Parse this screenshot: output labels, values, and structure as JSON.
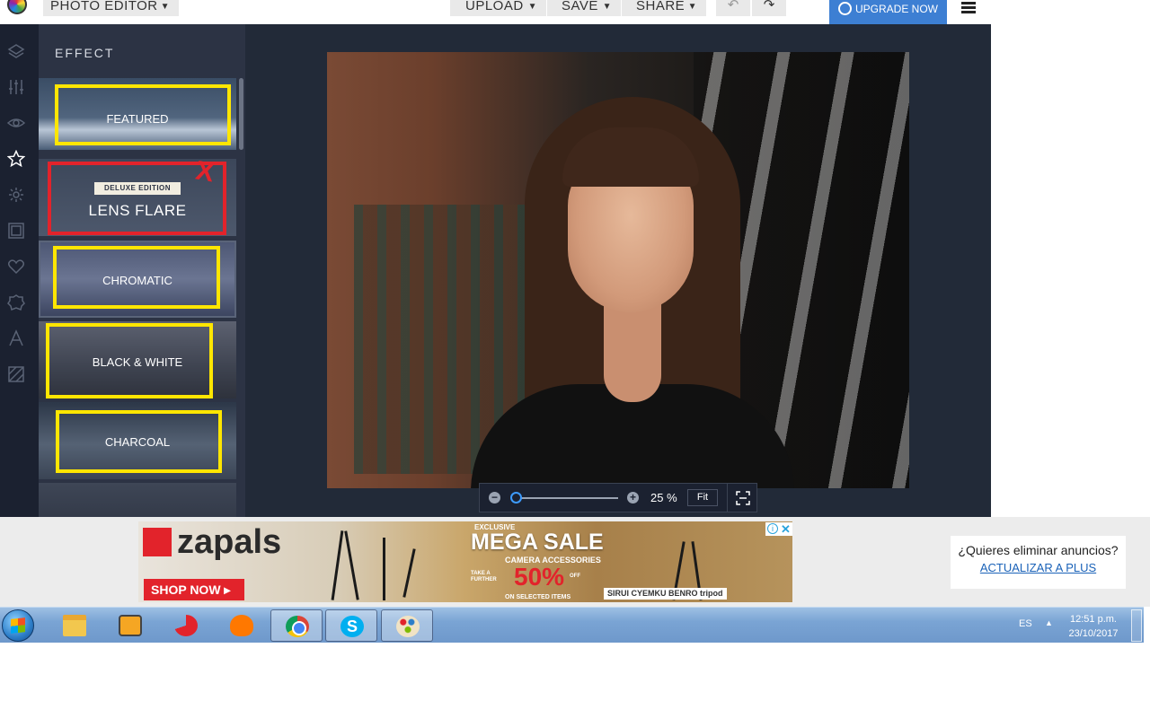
{
  "topbar": {
    "app_menu": "PHOTO EDITOR",
    "upload": "UPLOAD",
    "save": "SAVE",
    "share": "SHARE",
    "upgrade": "UPGRADE NOW",
    "caret": "▼",
    "undo_glyph": "↶",
    "redo_glyph": "↷"
  },
  "rail": {
    "icons": [
      "layers-icon",
      "sliders-icon",
      "eye-icon",
      "star-icon",
      "sparkle-icon",
      "frame-icon",
      "heart-icon",
      "badge-icon",
      "text-icon",
      "texture-icon"
    ],
    "active": "star-icon"
  },
  "effects": {
    "title": "EFFECT",
    "items": [
      {
        "label": "FEATURED"
      },
      {
        "label": "LENS FLARE",
        "ribbon": "DELUXE EDITION",
        "mark": "X"
      },
      {
        "label": "CHROMATIC"
      },
      {
        "label": "BLACK & WHITE"
      },
      {
        "label": "CHARCOAL"
      }
    ],
    "highlight_color": "#ffe600",
    "reject_color": "#e2232b"
  },
  "zoom": {
    "minus": "−",
    "plus": "+",
    "value": "25 %",
    "fit": "Fit",
    "level": 0.0
  },
  "ad": {
    "brand": "zapals",
    "cta": "SHOP NOW ▸",
    "exclusive": "EXCLUSIVE",
    "headline": "MEGA SALE",
    "sub": "CAMERA ACCESSORIES",
    "take": "TAKE A FURTHER",
    "discount": "50%",
    "off": "OFF",
    "on_selected": "ON SELECTED ITEMS",
    "brands": "SIRUI  CYEMKU  BENRO  tripod",
    "info": "i",
    "close": "✕"
  },
  "remove_ads": {
    "question": "¿Quieres eliminar anuncios?",
    "link": "ACTUALIZAR A PLUS"
  },
  "taskbar": {
    "apps": [
      "windows-explorer",
      "media-player",
      "ccleaner",
      "avast",
      "chrome",
      "skype",
      "paint"
    ],
    "open_apps": [
      "chrome",
      "skype",
      "paint"
    ],
    "skype_letter": "S",
    "lang": "ES",
    "tray_arrow": "▲",
    "time": "12:51 p.m.",
    "date": "23/10/2017"
  }
}
